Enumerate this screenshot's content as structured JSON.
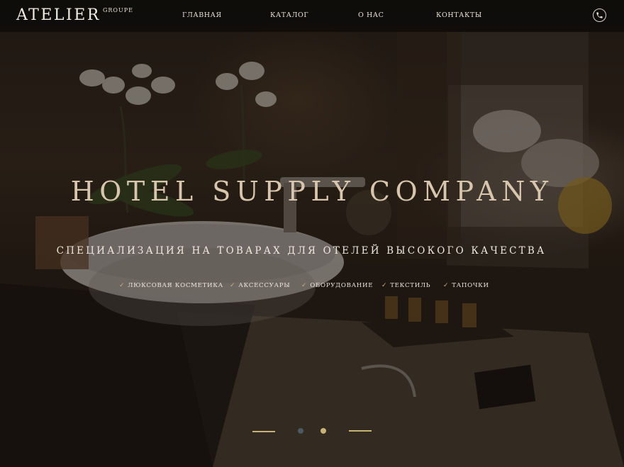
{
  "header": {
    "logo": "ATELIER",
    "logo_sup": "GROUPE",
    "nav": [
      "ГЛАВНАЯ",
      "КАТАЛОГ",
      "О НАС",
      "КОНТАКТЫ"
    ],
    "phone_icon": "phone-icon"
  },
  "hero": {
    "headline": "HOTEL SUPPLY COMPANY",
    "subline": "СПЕЦИАЛИЗАЦИЯ НА ТОВАРАХ ДЛЯ ОТЕЛЕЙ ВЫСОКОГО КАЧЕСТВА",
    "features": [
      "ЛЮКСОВАЯ КОСМЕТИКА",
      "АКСЕССУАРЫ",
      "ОБОРУДОВАНИЕ",
      "ТЕКСТИЛЬ",
      "ТАПОЧКИ"
    ],
    "check_icon": "check-icon",
    "check_glyph": "✓"
  },
  "slider": {
    "slides": 3,
    "active_slide": 2
  },
  "colors": {
    "accent": "#c9b17a",
    "headline": "#d7c6ad",
    "header_bg": "#0c0a09",
    "inactive_dot": "#5a6470"
  }
}
